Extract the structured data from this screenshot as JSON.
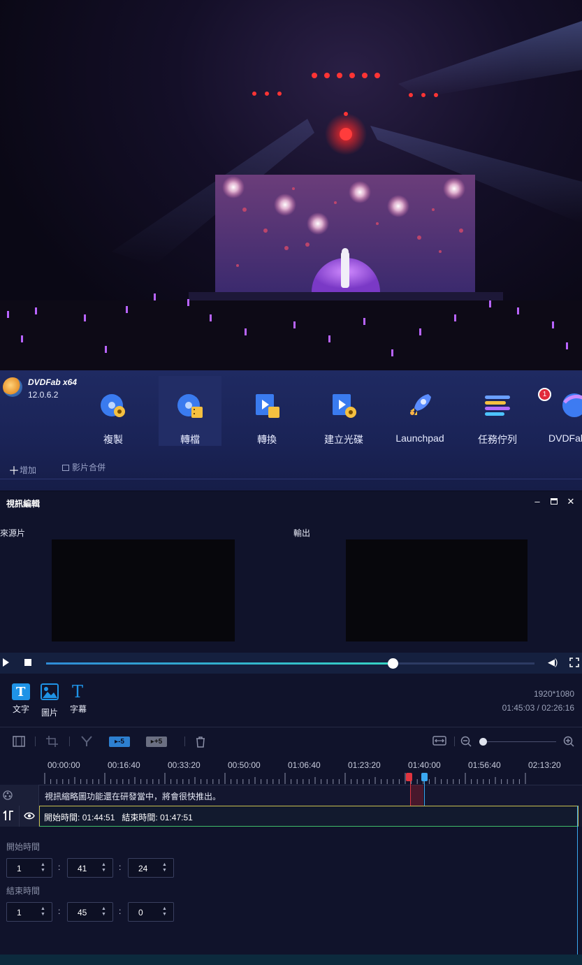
{
  "app": {
    "brand": "DVDFab x64",
    "version": "12.0.6.2",
    "tools": [
      {
        "label": "複製",
        "icon": "disc-copy-icon"
      },
      {
        "label": "轉檔",
        "icon": "disc-ripper-icon"
      },
      {
        "label": "轉換",
        "icon": "video-converter-icon"
      },
      {
        "label": "建立光碟",
        "icon": "video-creator-icon"
      },
      {
        "label": "Launchpad",
        "icon": "rocket-icon"
      },
      {
        "label": "任務佇列",
        "icon": "task-queue-icon"
      },
      {
        "label": "DVDFab",
        "icon": "dvdfab-icon"
      }
    ],
    "queue_badge": "1",
    "add_label": "增加",
    "merge_label": "影片合併"
  },
  "editor": {
    "title": "視訊編輯",
    "source_label": "來源片",
    "output_label": "輸出",
    "playback_progress": 0.71,
    "watermark_buttons": [
      {
        "label": "文字",
        "icon": "text-watermark-icon"
      },
      {
        "label": "圖片",
        "icon": "image-watermark-icon"
      },
      {
        "label": "字幕",
        "icon": "subtitle-icon"
      }
    ],
    "resolution": "1920*1080",
    "time_position": "01:45:03 / 02:26:16",
    "step_back": "-5",
    "step_forward": "+5",
    "timeline_ticks": [
      "00:00:00",
      "00:16:40",
      "00:33:20",
      "00:50:00",
      "01:06:40",
      "01:23:20",
      "01:40:00",
      "01:56:40",
      "02:13:20"
    ],
    "thumbnail_notice": "視訊縮略圖功能還在研發當中，將會很快推出。",
    "clip_start_label": "開始時間:",
    "clip_start": "01:44:51",
    "clip_end_label": "結束時間:",
    "clip_end": "01:47:51",
    "start_time_label": "開始時間",
    "start_time": {
      "h": "1",
      "m": "41",
      "s": "24"
    },
    "end_time_label": "結束時間",
    "end_time": {
      "h": "1",
      "m": "45",
      "s": "0"
    },
    "zoom_level": 0
  }
}
